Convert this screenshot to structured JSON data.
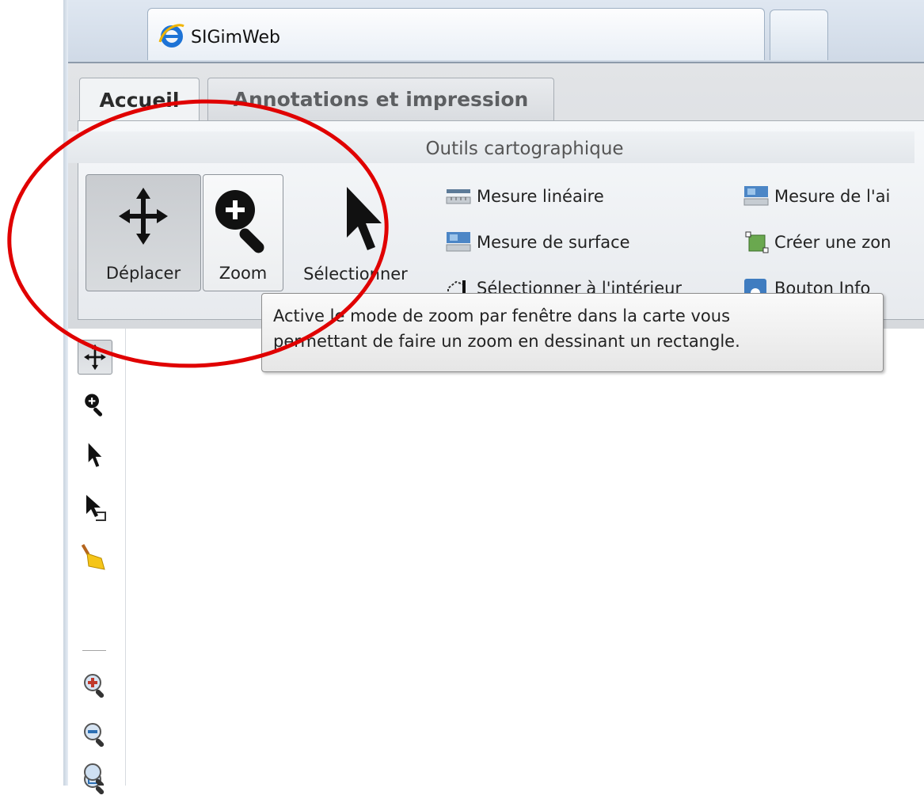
{
  "browser": {
    "tab_title": "SIGimWeb"
  },
  "ribbon": {
    "tabs": [
      {
        "label": "Accueil",
        "active": true
      },
      {
        "label": "Annotations et impression",
        "active": false
      }
    ],
    "group_title": "Outils cartographique",
    "big_buttons": [
      {
        "label": "Déplacer",
        "icon": "move-arrows-icon",
        "state": "pressed"
      },
      {
        "label": "Zoom",
        "icon": "zoom-in-icon",
        "state": "hover"
      },
      {
        "label": "Sélectionner",
        "icon": "cursor-arrow-icon",
        "state": "normal"
      }
    ],
    "small_buttons": [
      {
        "label": "Mesure linéaire",
        "icon": "ruler-icon"
      },
      {
        "label": "Mesure de surface",
        "icon": "area-measure-icon"
      },
      {
        "label": "Sélectionner à l'intérieur",
        "icon": "select-inside-icon"
      },
      {
        "label": "Mesure de l'ai",
        "icon": "area-measure-icon"
      },
      {
        "label": "Créer une zon",
        "icon": "create-zone-icon"
      },
      {
        "label": "Bouton Info",
        "icon": "info-icon"
      }
    ]
  },
  "tooltip": {
    "text_line1": "Active le mode de zoom par fenêtre dans la carte vous",
    "text_line2": "permettant de faire un zoom en dessinant un rectangle."
  },
  "vertical_toolbar": {
    "items": [
      "move-arrows-icon",
      "zoom-in-icon",
      "cursor-arrow-icon",
      "select-inside-icon",
      "broom-icon",
      "zoom-plus-icon",
      "zoom-minus-icon",
      "zoom-extent-icon",
      "zoom-full-icon"
    ]
  },
  "colors": {
    "annotation_red": "#e00000",
    "ribbon_bg": "#e2e4e7",
    "tooltip_bg": "#f2f2f2"
  }
}
